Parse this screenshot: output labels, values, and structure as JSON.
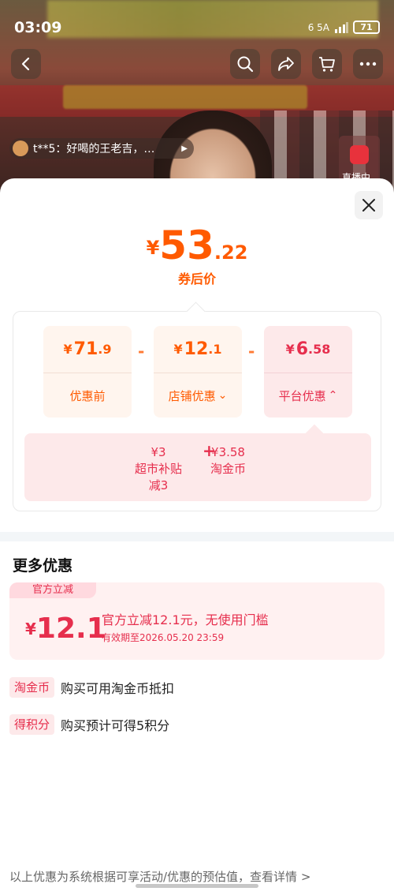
{
  "status_bar": {
    "time": "03:09",
    "network": "6 5A",
    "battery": "71"
  },
  "nav": {
    "back_icon": "chevron-left-icon",
    "search_icon": "search-icon",
    "share_icon": "share-icon",
    "cart_icon": "cart-icon",
    "more_icon": "more-icon"
  },
  "live_comment": {
    "text": "t**5：好喝的王老吉，…"
  },
  "live_badge": {
    "label": "直播中"
  },
  "price_sheet": {
    "final_price": {
      "currency": "¥",
      "integer": "53",
      "decimal": ".22",
      "label": "券后价"
    },
    "breakdown": [
      {
        "currency": "¥",
        "integer": "71",
        "decimal": ".9",
        "label": "优惠前"
      },
      {
        "currency": "¥",
        "integer": "12",
        "decimal": ".1",
        "label": "店铺优惠",
        "arrow": "⌄"
      },
      {
        "currency": "¥",
        "integer": "6",
        "decimal": ".58",
        "label": "平台优惠",
        "arrow": "⌃"
      }
    ],
    "operators": [
      "-",
      "-"
    ],
    "platform_detail": {
      "items": [
        {
          "amount": "¥3",
          "name": "超市补贴",
          "note": "减3"
        },
        {
          "amount": "¥3.58",
          "name": "淘金币"
        }
      ],
      "operator": "+"
    }
  },
  "more_offers": {
    "title": "更多优惠",
    "coupon": {
      "tag": "官方立减",
      "currency": "¥",
      "amount": "12.1",
      "description": "官方立减12.1元，无使用门槛",
      "expiry": "有效期至2026.05.20 23:59"
    },
    "rows": [
      {
        "badge": "淘金币",
        "text": "购买可用淘金币抵扣"
      },
      {
        "badge": "得积分",
        "text": "购买预计可得5积分"
      }
    ]
  },
  "footer": {
    "note": "以上优惠为系统根据可享活动/优惠的预估值，查看详情 >"
  },
  "colors": {
    "accent_orange": "#ff5a00",
    "accent_red": "#e62e4d"
  }
}
